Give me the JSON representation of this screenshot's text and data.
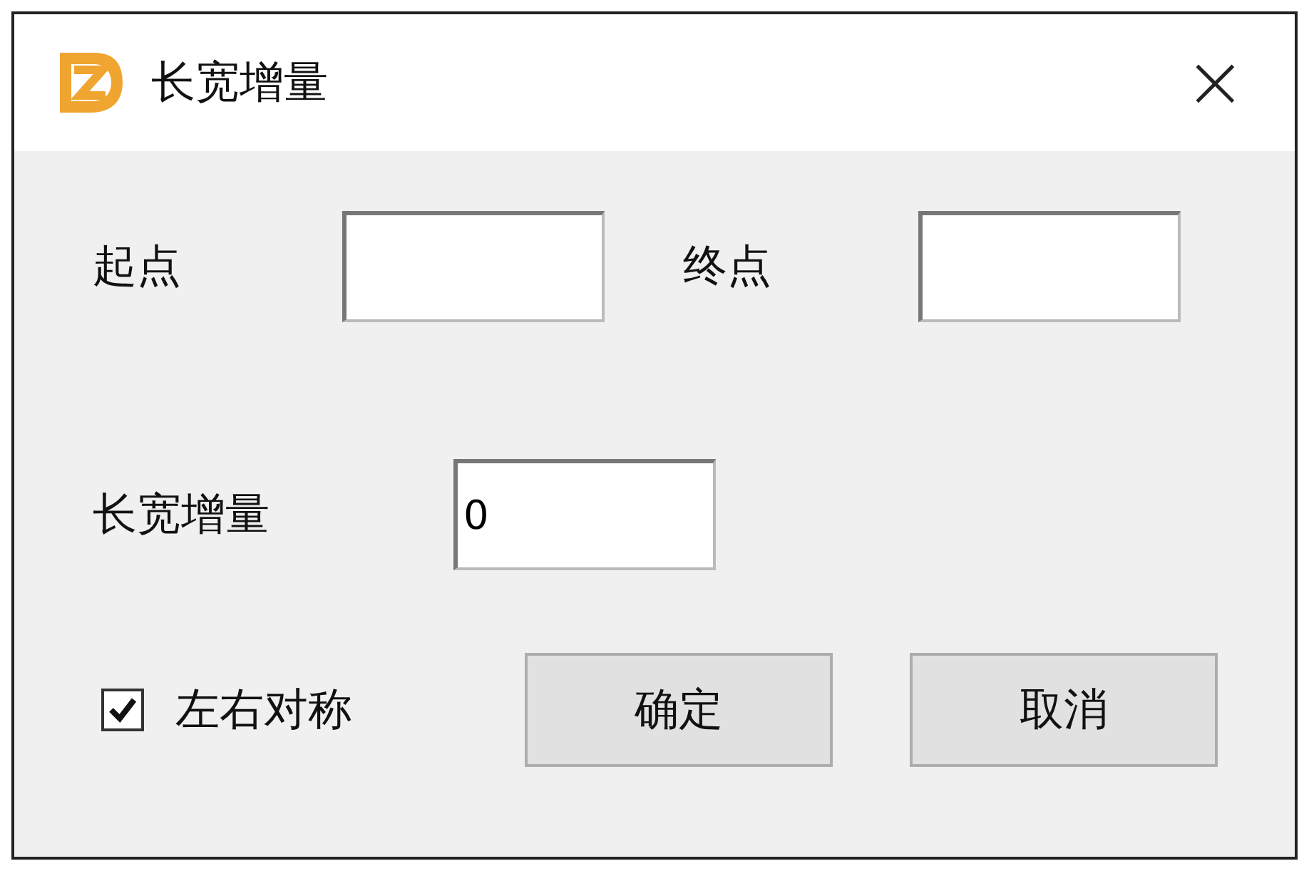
{
  "window": {
    "title": "长宽增量",
    "close": "×"
  },
  "fields": [
    {
      "label": "起点"
    },
    {
      "label": "终点"
    }
  ],
  "increment": {
    "label": "长宽增量",
    "value": "0"
  },
  "symmetric": {
    "label": "左右对称",
    "checked": true
  },
  "buttons": [
    "确定",
    "取消"
  ]
}
